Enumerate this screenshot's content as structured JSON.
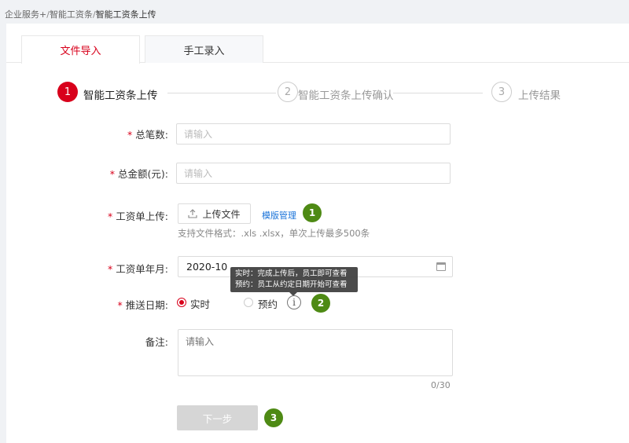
{
  "breadcrumb": {
    "items": [
      "企业服务+",
      "智能工资条",
      "智能工资条上传"
    ],
    "separator": "/"
  },
  "tabs": [
    {
      "label": "文件导入",
      "active": true
    },
    {
      "label": "手工录入",
      "active": false
    }
  ],
  "steps": [
    {
      "number": "1",
      "label": "智能工资条上传",
      "status": "active"
    },
    {
      "number": "2",
      "label": "智能工资条上传确认",
      "status": "todo"
    },
    {
      "number": "3",
      "label": "上传结果",
      "status": "todo"
    }
  ],
  "form": {
    "required_mark": "*",
    "total_count": {
      "label": "总笔数:",
      "placeholder": "请输入"
    },
    "total_amount": {
      "label": "总金额(元):",
      "placeholder": "请输入"
    },
    "salary_upload": {
      "label": "工资单上传:",
      "button_label": "上传文件",
      "upload_icon": "upload-icon",
      "template_link": "模版管理",
      "hint": "支持文件格式：.xls .xlsx，单次上传最多500条"
    },
    "salary_month": {
      "label": "工资单年月:",
      "value": "2020-10",
      "icon": "calendar-icon"
    },
    "push_date": {
      "label": "推送日期:",
      "options": [
        {
          "label": "实时",
          "checked": true
        },
        {
          "label": "预约",
          "checked": false
        }
      ],
      "info_icon": "info-icon",
      "info_glyph": "i",
      "tooltip": [
        "实时：完成上传后，员工即可查看",
        "预约：员工从约定日期开始可查看"
      ]
    },
    "remark": {
      "label": "备注:",
      "placeholder": "请输入",
      "counter": "0/30"
    },
    "next_button": "下一步"
  },
  "callouts": [
    "1",
    "2",
    "3"
  ],
  "colors": {
    "accent": "#d8001b",
    "callout": "#4e8a14",
    "link": "#1a73d9",
    "disabled_button": "#d6d6d6"
  }
}
